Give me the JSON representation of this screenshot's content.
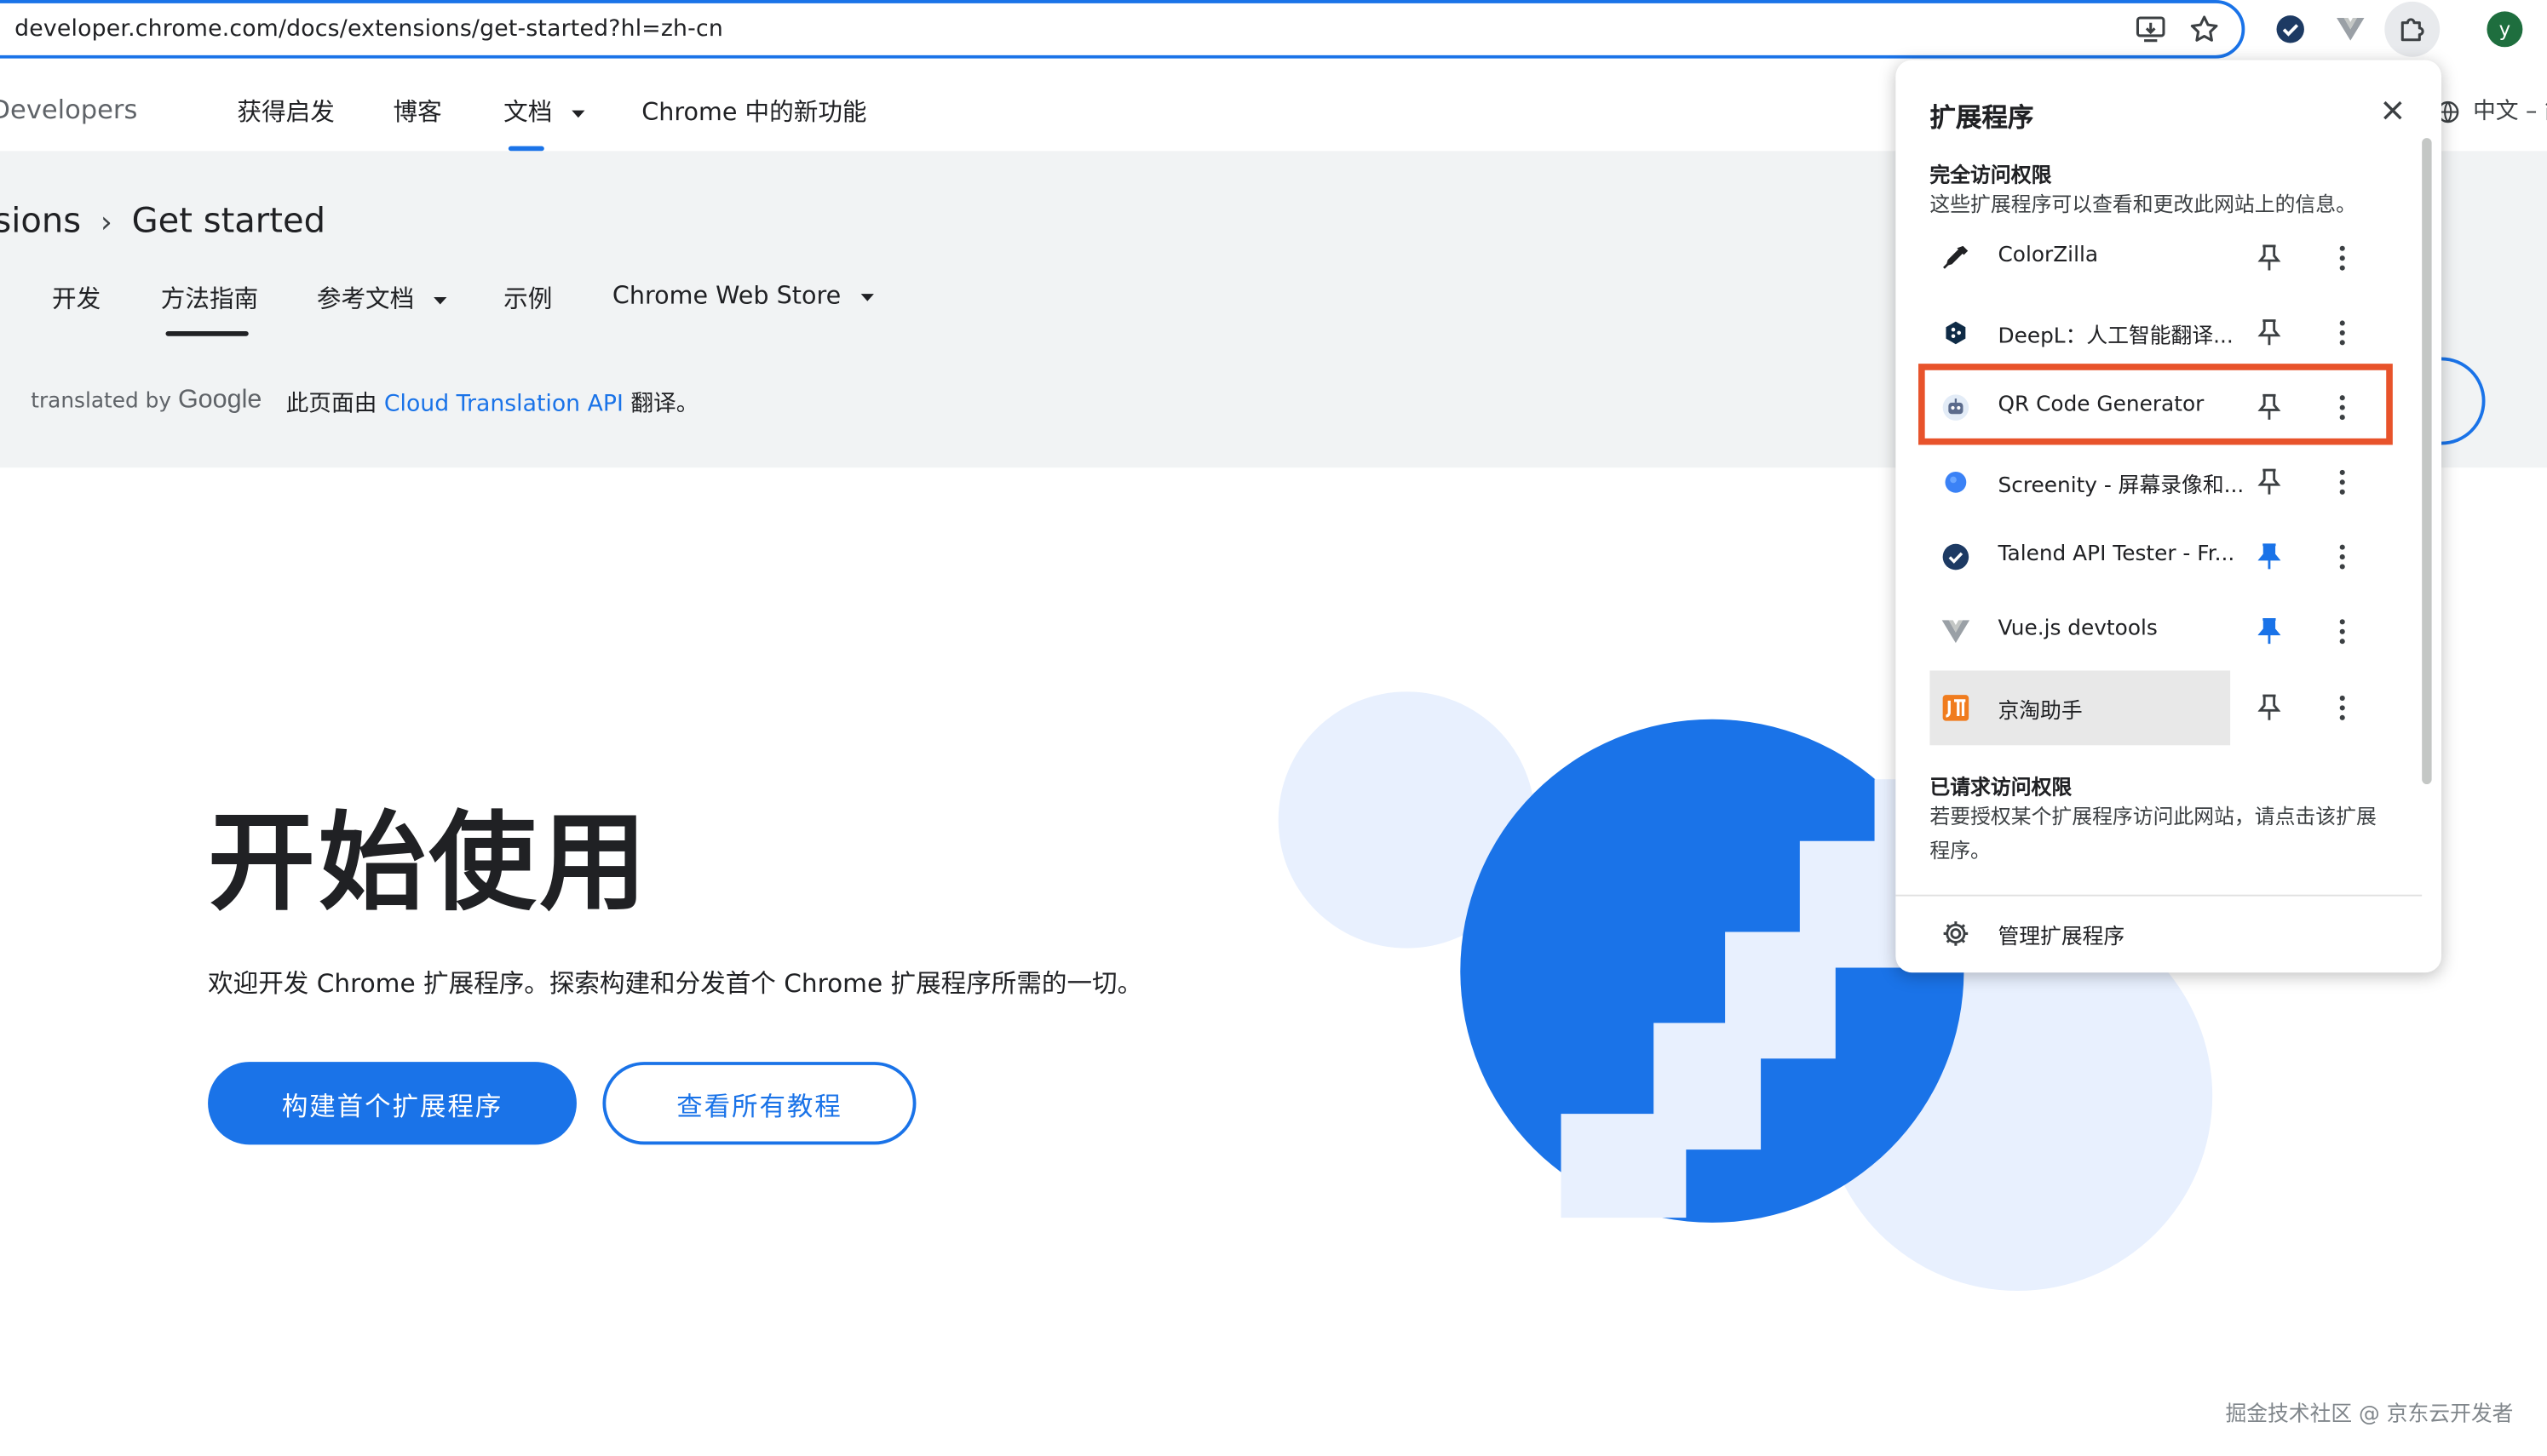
{
  "browser": {
    "url": "developer.chrome.com/docs/extensions/get-started?hl=zh-cn",
    "avatar_letter": "y"
  },
  "site_nav": {
    "brand": "Developers",
    "links": [
      "获得启发",
      "博客",
      "文档",
      "Chrome 中的新功能"
    ],
    "language": "中文 – 简"
  },
  "breadcrumb": {
    "parent": "sions",
    "current": "Get started"
  },
  "subtabs": [
    "开发",
    "方法指南",
    "参考文档",
    "示例",
    "Chrome Web Store"
  ],
  "translation": {
    "prefix": "translated by",
    "brand": "Google",
    "note_before": "此页面由 ",
    "note_link": "Cloud Translation API",
    "note_after": " 翻译。"
  },
  "hero": {
    "title": "开始使用",
    "description": "欢迎开发 Chrome 扩展程序。探索构建和分发首个 Chrome 扩展程序所需的一切。",
    "primary_button": "构建首个扩展程序",
    "secondary_button": "查看所有教程"
  },
  "extensions_popup": {
    "title": "扩展程序",
    "full_access_heading": "完全访问权限",
    "full_access_desc": "这些扩展程序可以查看和更改此网站上的信息。",
    "items": [
      {
        "name": "ColorZilla",
        "icon": "eyedropper-icon",
        "pinned": false
      },
      {
        "name": "DeepL：人工智能翻译...",
        "icon": "deepl-icon",
        "pinned": false
      },
      {
        "name": "QR Code Generator",
        "icon": "qr-robot-icon",
        "pinned": false
      },
      {
        "name": "Screenity - 屏幕录像和...",
        "icon": "screenity-icon",
        "pinned": false
      },
      {
        "name": "Talend API Tester - Fr...",
        "icon": "talend-check-icon",
        "pinned": true
      },
      {
        "name": "Vue.js devtools",
        "icon": "vue-icon",
        "pinned": true
      },
      {
        "name": "京淘助手",
        "icon": "jingtao-icon",
        "pinned": false
      }
    ],
    "requested_heading": "已请求访问权限",
    "requested_desc": "若要授权某个扩展程序访问此网站，请点击该扩展程序。",
    "manage_label": "管理扩展程序"
  },
  "colors": {
    "accent": "#1a73e8",
    "highlight_border": "#e8532b",
    "header_bg": "#f1f3f4"
  },
  "watermark": "掘金技术社区 @ 京东云开发者"
}
